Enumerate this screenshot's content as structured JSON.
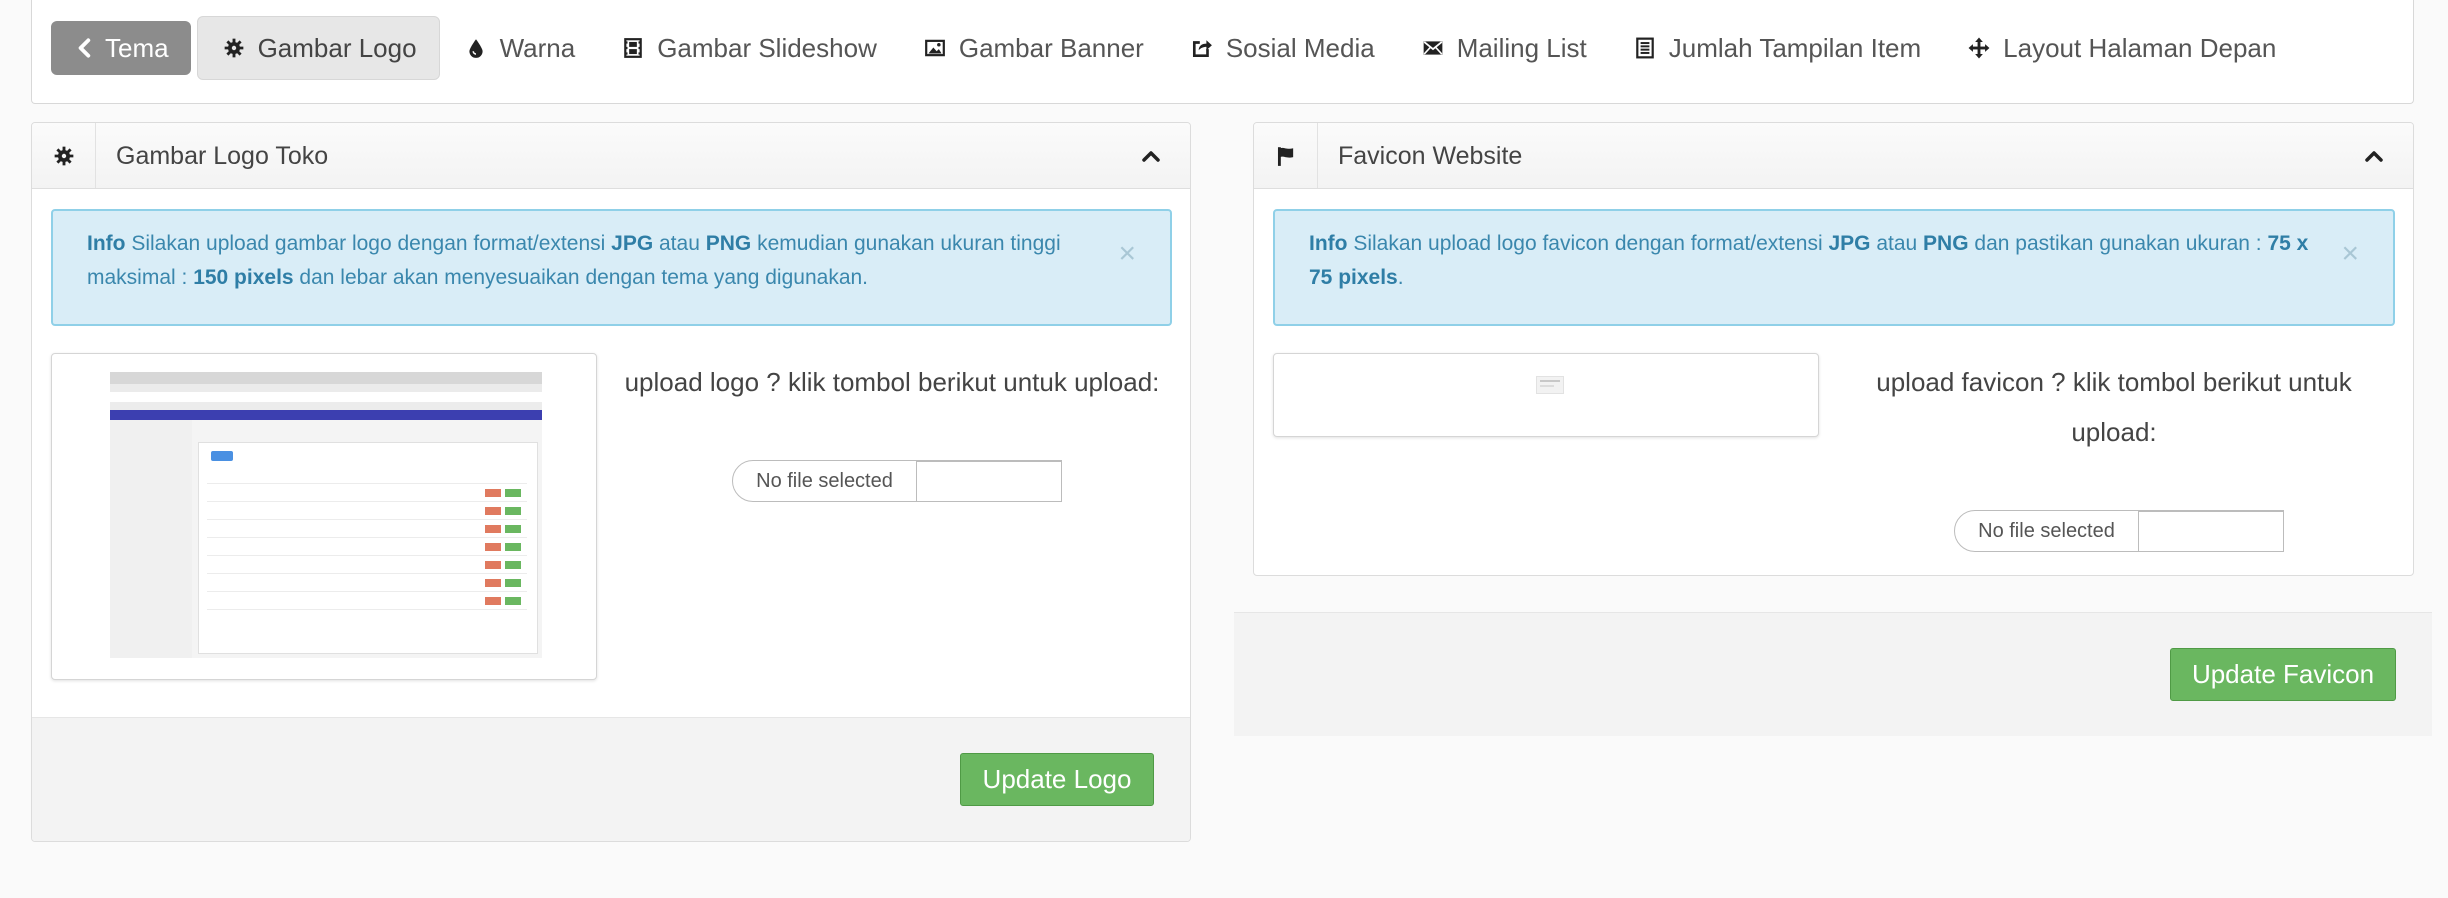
{
  "tabs": [
    {
      "label": "Tema",
      "icon": "chevron-left-icon"
    },
    {
      "label": "Gambar Logo",
      "icon": "cog-icon"
    },
    {
      "label": "Warna",
      "icon": "droplet-icon"
    },
    {
      "label": "Gambar Slideshow",
      "icon": "film-icon"
    },
    {
      "label": "Gambar Banner",
      "icon": "picture-icon"
    },
    {
      "label": "Sosial Media",
      "icon": "share-icon"
    },
    {
      "label": "Mailing List",
      "icon": "envelope-icon"
    },
    {
      "label": "Jumlah Tampilan Item",
      "icon": "list-icon"
    },
    {
      "label": "Layout Halaman Depan",
      "icon": "move-icon"
    }
  ],
  "logo_panel": {
    "title": "Gambar Logo Toko",
    "info": {
      "prefix": "Info",
      "text1": " Silakan upload gambar logo dengan format/extensi ",
      "fmt1": "JPG",
      "text2": " atau ",
      "fmt2": "PNG",
      "text3": " kemudian gunakan ukuran tinggi maksimal : ",
      "size": "150 pixels",
      "text4": " dan lebar akan menyesuaikan dengan tema yang digunakan."
    },
    "upload_label": "upload logo ? klik tombol berikut untuk upload:",
    "file_placeholder": "No file selected",
    "button": "Update Logo"
  },
  "favicon_panel": {
    "title": "Favicon Website",
    "info": {
      "prefix": "Info",
      "text1": " Silakan upload logo favicon dengan format/extensi ",
      "fmt1": "JPG",
      "text2": " atau ",
      "fmt2": "PNG",
      "text3": " dan pastikan gunakan ukuran : ",
      "size": "75 x 75 pixels",
      "text4": "."
    },
    "upload_label": "upload favicon ? klik tombol berikut untuk upload:",
    "file_placeholder": "No file selected",
    "button": "Update Favicon"
  },
  "colors": {
    "info_bg": "#d9edf7",
    "info_text": "#3a87ad",
    "green": "#6ab760",
    "back_tab": "#8c8c8c"
  }
}
